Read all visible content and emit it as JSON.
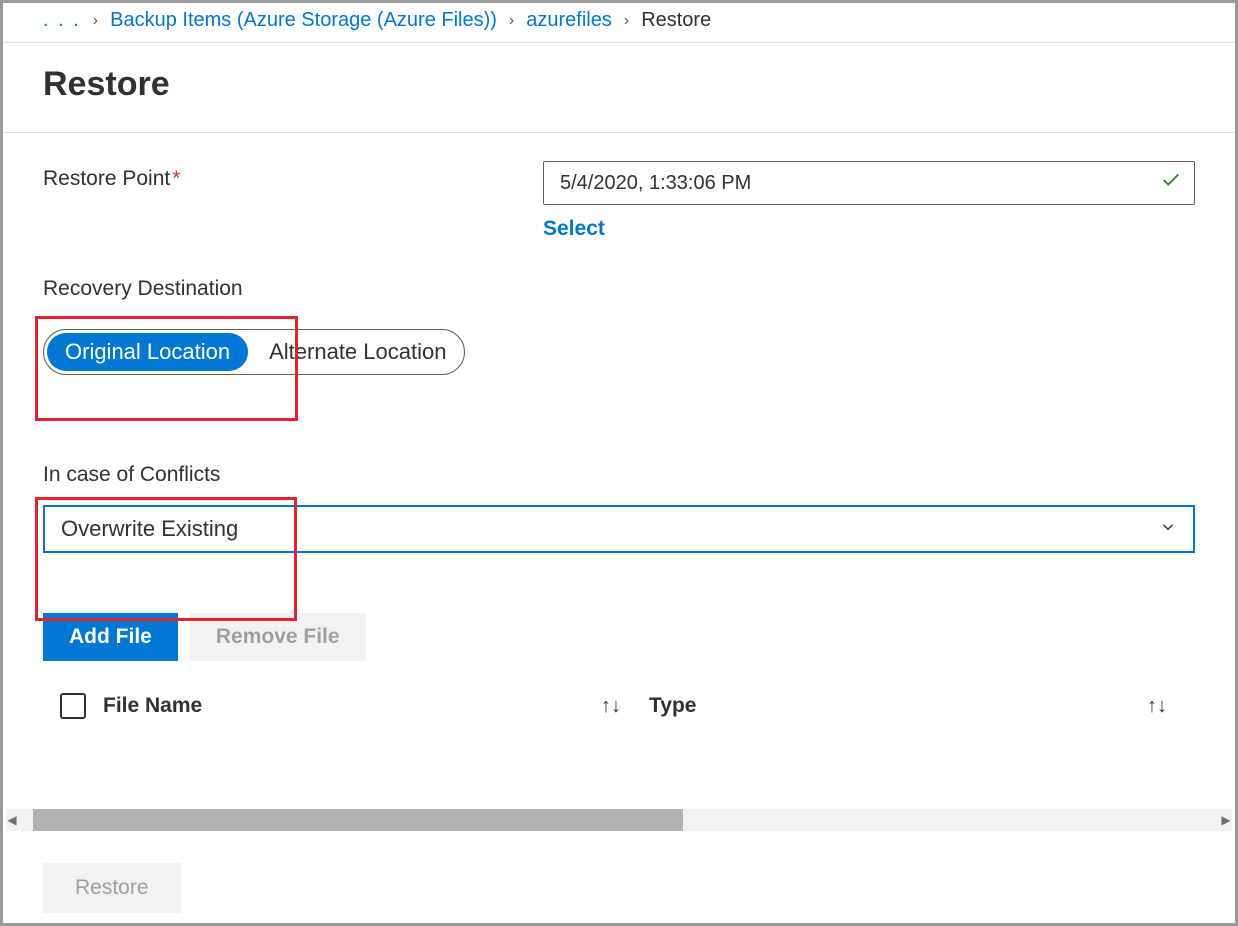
{
  "breadcrumb": {
    "ellipsis": ". . .",
    "items": [
      {
        "label": "Backup Items (Azure Storage (Azure Files))",
        "link": true
      },
      {
        "label": "azurefiles",
        "link": true
      },
      {
        "label": "Restore",
        "link": false
      }
    ]
  },
  "page_title": "Restore",
  "restore_point": {
    "label": "Restore Point",
    "value": "5/4/2020, 1:33:06 PM",
    "select_link": "Select"
  },
  "recovery_destination": {
    "label": "Recovery Destination",
    "options": [
      "Original Location",
      "Alternate Location"
    ],
    "selected": "Original Location"
  },
  "conflicts": {
    "label": "In case of Conflicts",
    "value": "Overwrite Existing"
  },
  "buttons": {
    "add_file": "Add File",
    "remove_file": "Remove File",
    "restore": "Restore"
  },
  "table": {
    "columns": [
      "File Name",
      "Type"
    ]
  }
}
